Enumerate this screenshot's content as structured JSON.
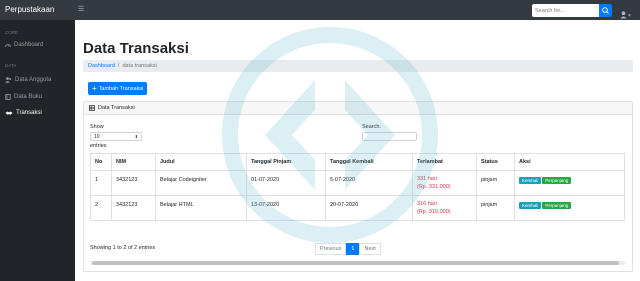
{
  "nav": {
    "brand": "Perpustakaan",
    "search_placeholder": "Search for..."
  },
  "sidebar": {
    "heading_core": "CORE",
    "heading_data": "DATA",
    "items": [
      {
        "label": "Dashboard",
        "icon": "dashboard-icon"
      },
      {
        "label": "Data Anggota",
        "icon": "users-icon"
      },
      {
        "label": "Data Buku",
        "icon": "book-icon"
      },
      {
        "label": "Transaksi",
        "icon": "handshake-icon"
      }
    ]
  },
  "page": {
    "title": "Data Transaksi",
    "breadcrumb": {
      "home": "Dashboard",
      "sep": "/",
      "current": "data transaksi"
    },
    "add_button": "Tambah Transaksi"
  },
  "card": {
    "title": "Data Transaksi",
    "show_label": "Show",
    "show_value": "10",
    "entries_label": "entries",
    "search_label": "Search:"
  },
  "table": {
    "headers": [
      "No",
      "NIM",
      "Judul",
      "Tanggal Pinjam",
      "Tanggal Kembali",
      "Terlambat",
      "Status",
      "Aksi"
    ],
    "rows": [
      {
        "no": "1",
        "nim": "3432123",
        "judul": "Belajar Codeigniter",
        "pinjam": "01-07-2020",
        "kembali": "5-07-2020",
        "terlambat_hari": "331 hari",
        "terlambat_denda": "(Rp. 331.000)",
        "status": "pinjam"
      },
      {
        "no": "2",
        "nim": "3432123",
        "judul": "Belajar HTML",
        "pinjam": "13-07-2020",
        "kembali": "20-07-2020",
        "terlambat_hari": "316 hari",
        "terlambat_denda": "(Rp. 316.000)",
        "status": "pinjam"
      }
    ],
    "btn_kembali": "Kembali",
    "btn_perpanjang": "Perpanjang"
  },
  "footer": {
    "info": "Showing 1 to 2 of 2 entries",
    "previous": "Previous",
    "page": "1",
    "next": "Next"
  },
  "colors": {
    "primary": "#007bff",
    "sidebar": "#212529",
    "topnav": "#343a40",
    "danger": "#dc3545",
    "info": "#17a2b8",
    "success": "#28a745"
  }
}
